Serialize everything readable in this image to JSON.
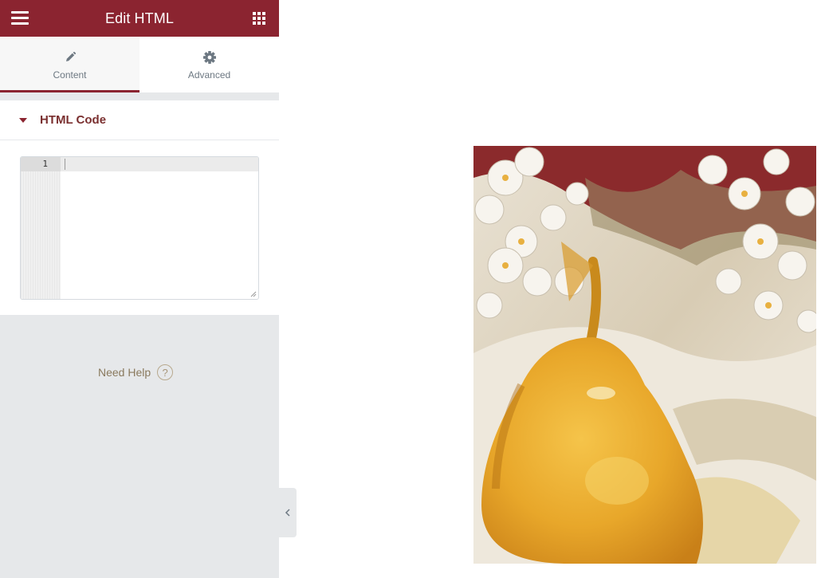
{
  "panel": {
    "title": "Edit HTML",
    "tabs": [
      {
        "label": "Content",
        "icon": "pencil-icon",
        "active": true
      },
      {
        "label": "Advanced",
        "icon": "gear-icon",
        "active": false
      }
    ],
    "section": {
      "label": "HTML Code",
      "editor": {
        "line_number": "1",
        "value": ""
      }
    },
    "help_label": "Need Help",
    "help_glyph": "?"
  },
  "colors": {
    "brand": "#8b2430",
    "panel_bg": "#e6e8ea"
  },
  "preview": {
    "image": "pear-with-blossoms"
  }
}
